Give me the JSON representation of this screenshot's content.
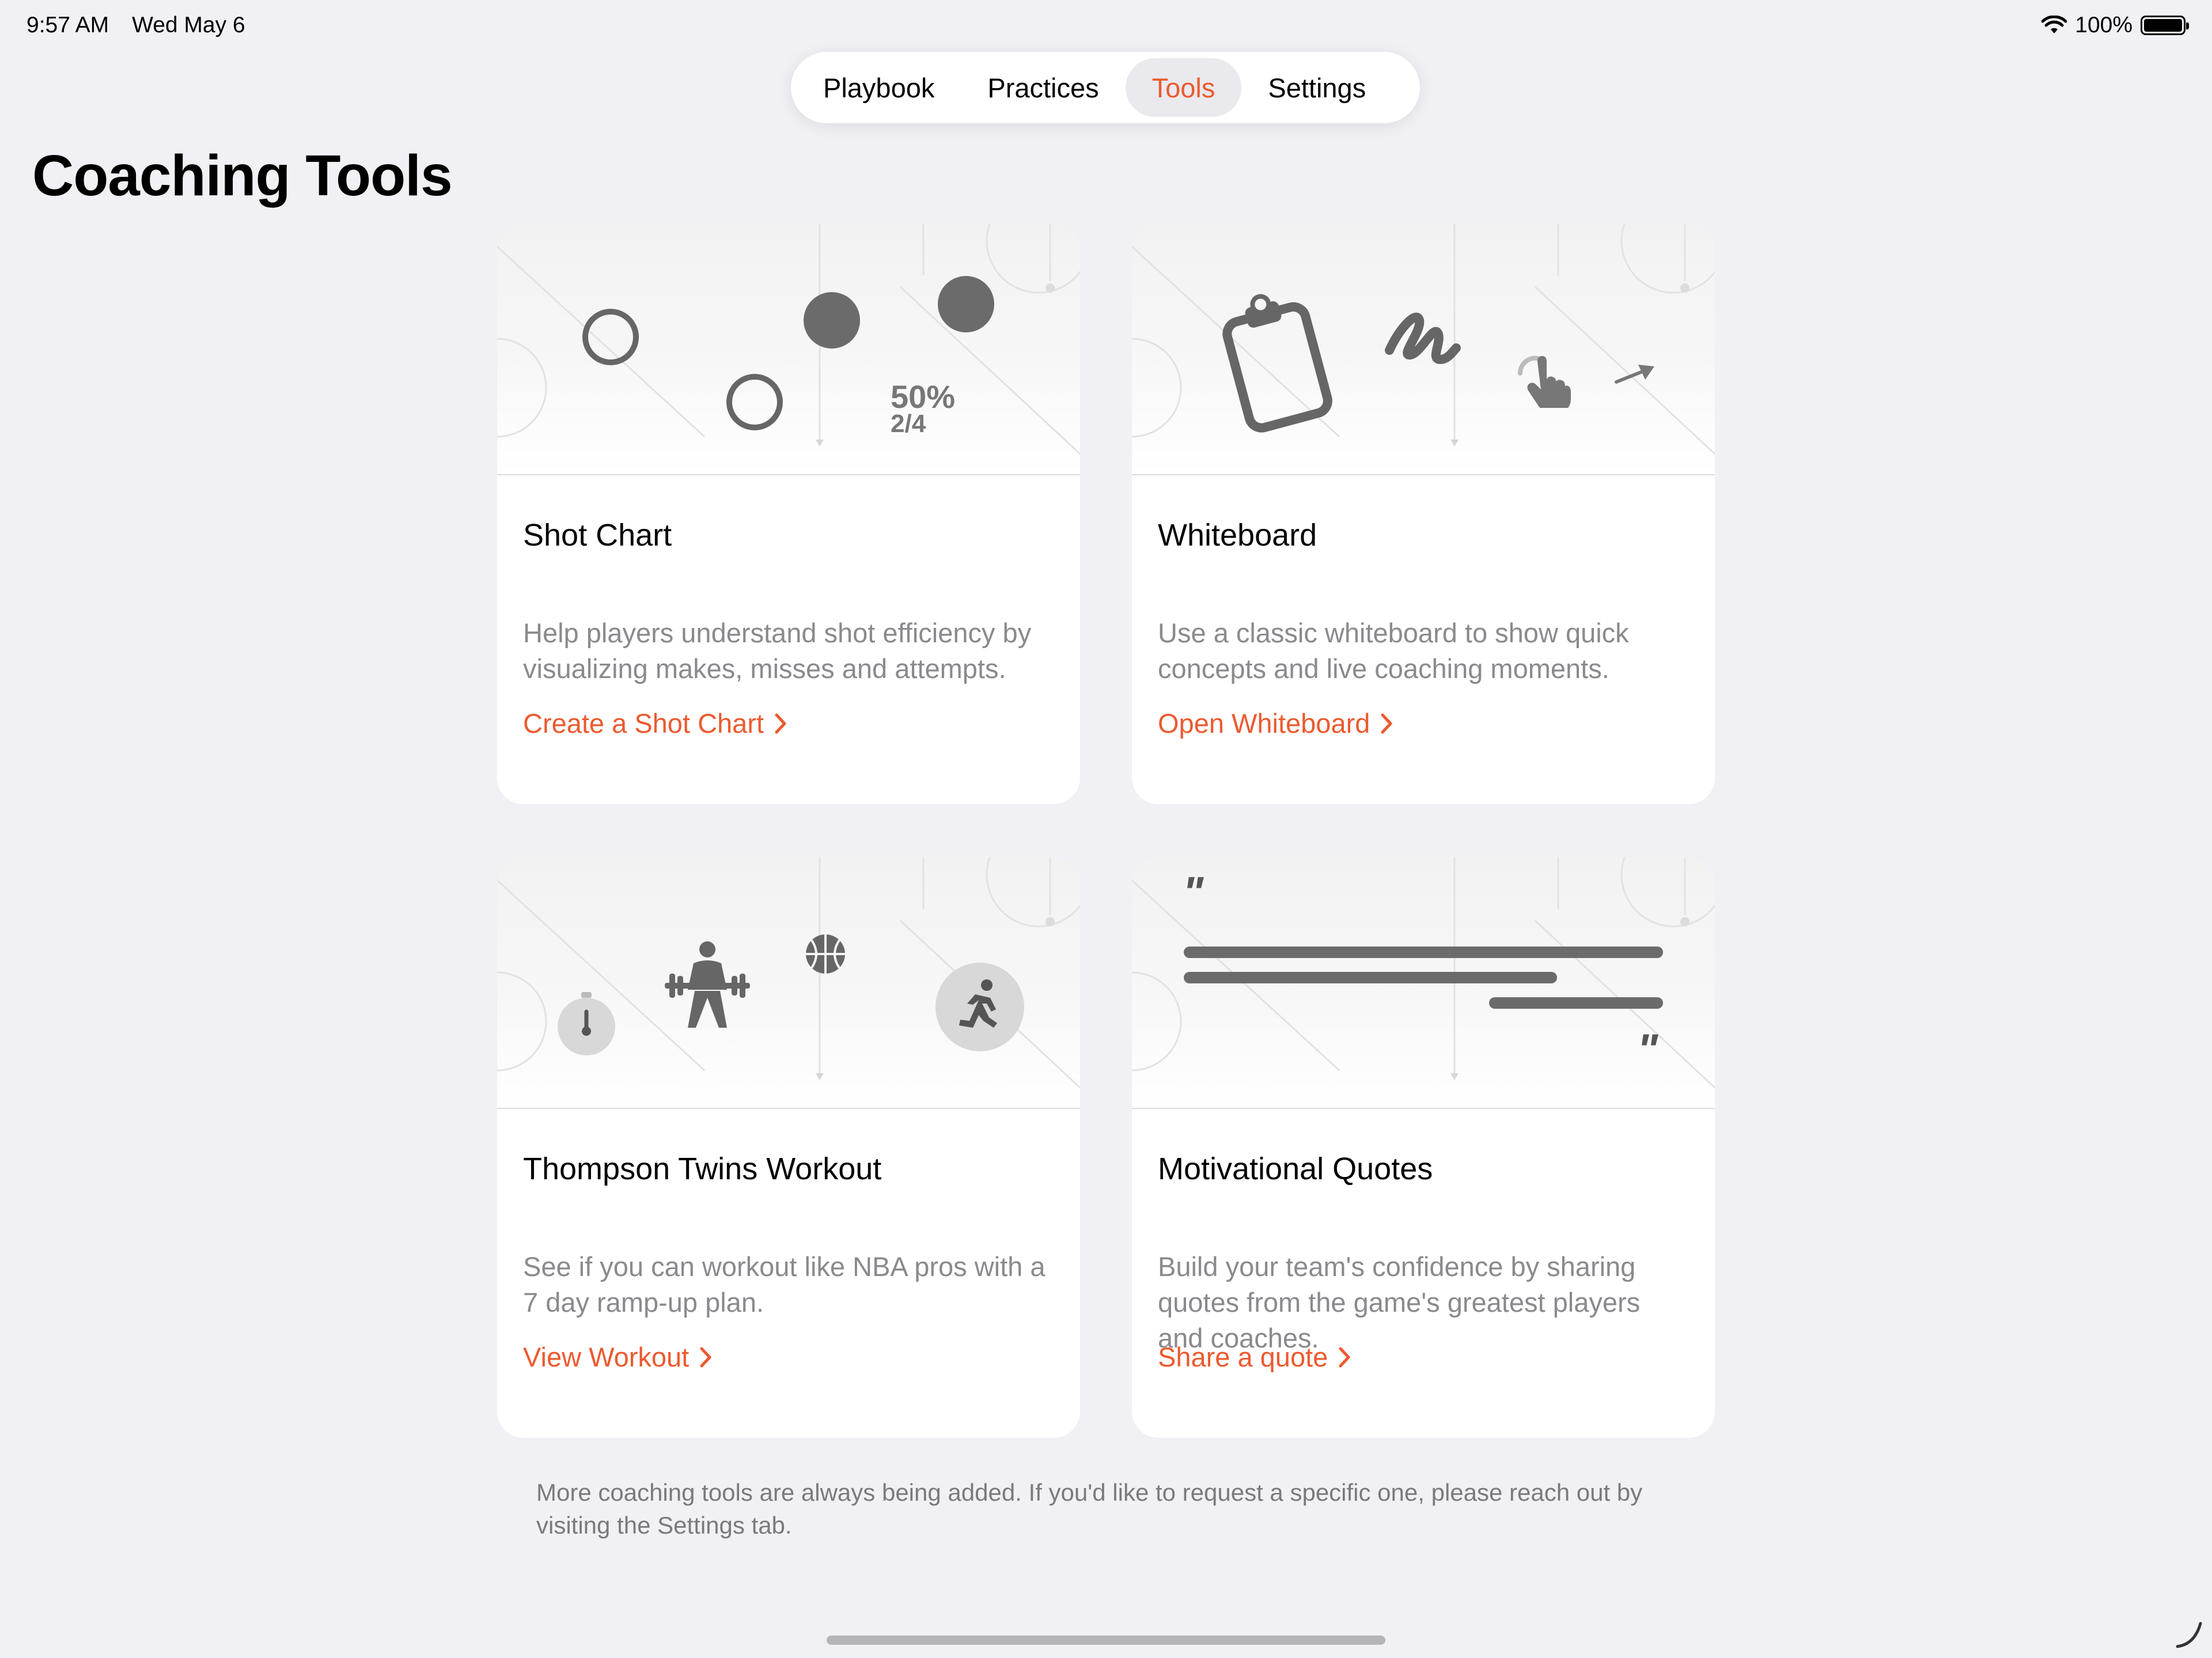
{
  "status_bar": {
    "time": "9:57 AM",
    "date": "Wed May 6",
    "battery": "100%",
    "icons": [
      "wifi-icon",
      "battery-icon"
    ]
  },
  "tabs": [
    {
      "label": "Playbook",
      "active": false
    },
    {
      "label": "Practices",
      "active": false
    },
    {
      "label": "Tools",
      "active": true
    },
    {
      "label": "Settings",
      "active": false
    }
  ],
  "page_title": "Coaching Tools",
  "accent_color": "#ec5a2f",
  "cards": [
    {
      "title": "Shot Chart",
      "description": "Help players understand shot efficiency by visualizing makes, misses and attempts.",
      "link": "Create a Shot Chart",
      "hero": {
        "percent": "50%",
        "ratio": "2/4",
        "icons": [
          "missed-shot-icon",
          "made-shot-icon"
        ]
      }
    },
    {
      "title": "Whiteboard",
      "description": "Use a classic whiteboard to show quick concepts and live coaching moments.",
      "link": "Open Whiteboard",
      "hero": {
        "icons": [
          "clipboard-icon",
          "scribble-icon",
          "tap-hand-icon",
          "arrow-icon"
        ]
      }
    },
    {
      "title": "Thompson Twins Workout",
      "description": "See if you can workout like NBA pros with a 7 day ramp-up plan.",
      "link": "View Workout",
      "hero": {
        "icons": [
          "stopwatch-icon",
          "weightlifter-icon",
          "basketball-icon",
          "runner-icon"
        ]
      }
    },
    {
      "title": "Motivational Quotes",
      "description": "Build your team's confidence by sharing quotes from the game's greatest players and coaches.",
      "link": "Share a quote",
      "hero": {
        "open_quote": "\"",
        "close_quote": "\"",
        "icons": [
          "quote-lines-icon"
        ]
      }
    }
  ],
  "footer_note": "More coaching tools are always being added. If you'd like to request a specific one, please reach out by visiting the Settings tab."
}
